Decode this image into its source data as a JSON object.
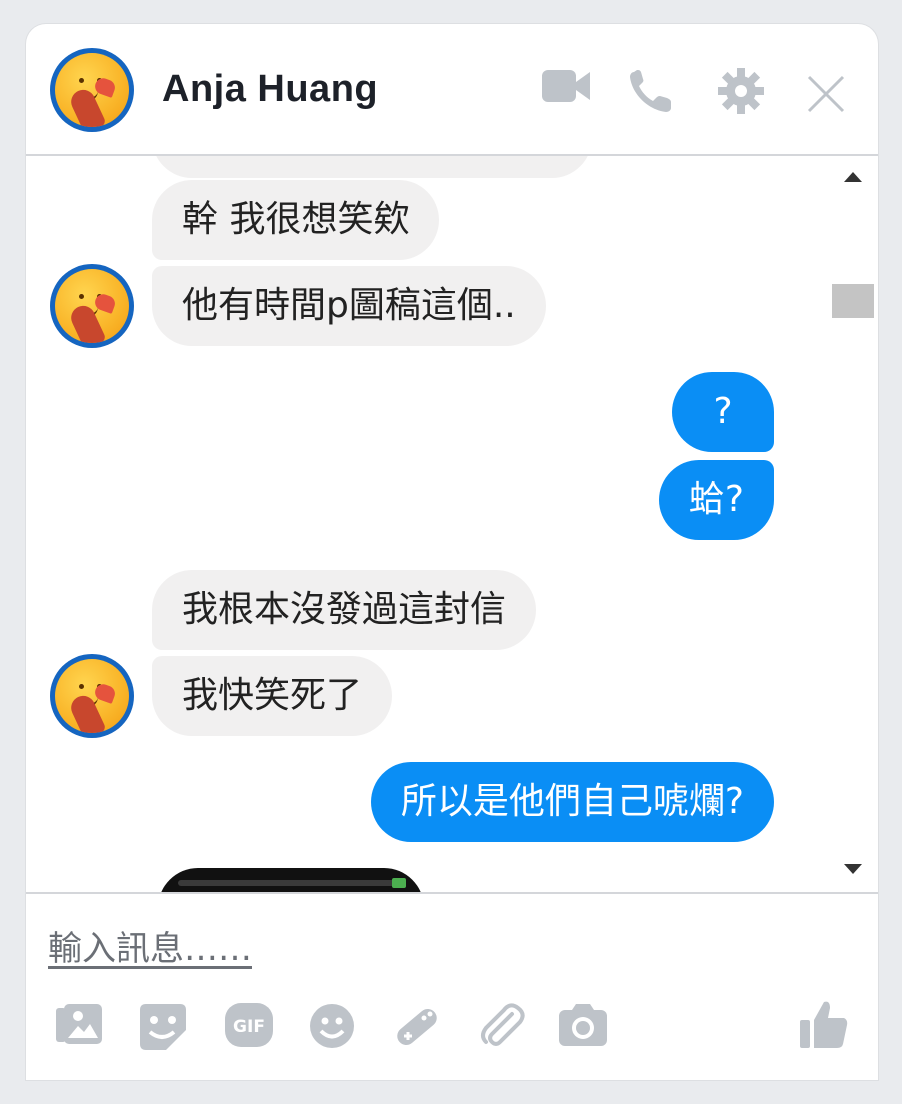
{
  "header": {
    "contact_name": "Anja Huang",
    "icons": [
      "video-camera-icon",
      "phone-icon",
      "gear-icon",
      "close-icon"
    ]
  },
  "messages": [
    {
      "side": "in",
      "text": "幹 我很想笑欸"
    },
    {
      "side": "in",
      "text": "他有時間p圖稿這個.."
    },
    {
      "side": "out",
      "text": "?"
    },
    {
      "side": "out",
      "text": "蛤?"
    },
    {
      "side": "in",
      "text": "我根本沒發過這封信"
    },
    {
      "side": "in",
      "text": "我快笑死了"
    },
    {
      "side": "out",
      "text": "所以是他們自己唬爛?"
    }
  ],
  "composer": {
    "placeholder": "輸入訊息……",
    "tools": [
      "photo-icon",
      "sticker-icon",
      "gif-icon",
      "emoji-icon",
      "game-icon",
      "attachment-icon",
      "camera-icon"
    ],
    "like": "thumbs-up-icon"
  },
  "colors": {
    "outgoing_bubble": "#0a8ef5",
    "incoming_bubble": "#f1f0f0",
    "icon_gray": "#bec3c9",
    "avatar_ring": "#1565c0"
  }
}
